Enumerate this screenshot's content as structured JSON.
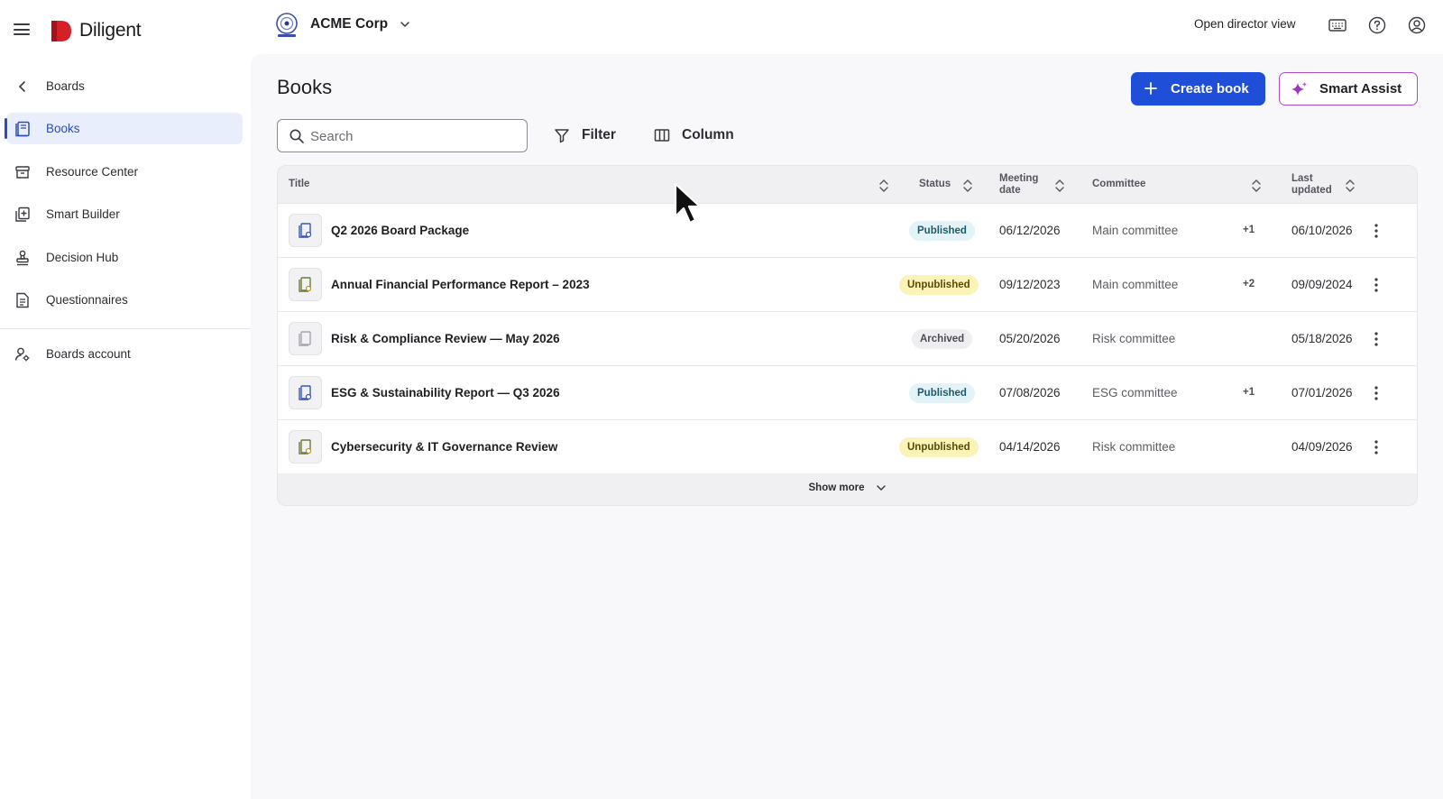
{
  "app": {
    "brand": "Diligent",
    "org_name": "ACME Corp",
    "director_link": "Open director view"
  },
  "sidebar": {
    "back_label": "Boards",
    "items": [
      {
        "label": "Books",
        "icon": "book-icon",
        "active": true
      },
      {
        "label": "Resource Center",
        "icon": "archive-icon",
        "active": false
      },
      {
        "label": "Smart Builder",
        "icon": "smart-builder-icon",
        "active": false
      },
      {
        "label": "Decision Hub",
        "icon": "stamp-icon",
        "active": false
      },
      {
        "label": "Questionnaires",
        "icon": "document-list-icon",
        "active": false
      }
    ],
    "account_label": "Boards account"
  },
  "page": {
    "title": "Books",
    "create_label": "Create book",
    "smart_assist_label": "Smart Assist",
    "search_placeholder": "Search",
    "filter_label": "Filter",
    "column_label": "Column",
    "show_more_label": "Show more"
  },
  "table": {
    "headers": {
      "title": "Title",
      "status": "Status",
      "meeting_date_1": "Meeting",
      "meeting_date_2": "date",
      "committee": "Committee",
      "last_updated_1": "Last",
      "last_updated_2": "updated"
    },
    "rows": [
      {
        "title": "Q2 2026 Board Package",
        "status": "Published",
        "meeting_date": "06/12/2026",
        "committee": "Main committee",
        "extra": "+1",
        "updated": "06/10/2026"
      },
      {
        "title": "Annual Financial Performance Report – 2023",
        "status": "Unpublished",
        "meeting_date": "09/12/2023",
        "committee": "Main committee",
        "extra": "+2",
        "updated": "09/09/2024"
      },
      {
        "title": "Risk & Compliance Review — May 2026",
        "status": "Archived",
        "meeting_date": "05/20/2026",
        "committee": "Risk committee",
        "extra": "",
        "updated": "05/18/2026"
      },
      {
        "title": "ESG & Sustainability Report — Q3 2026",
        "status": "Published",
        "meeting_date": "07/08/2026",
        "committee": "ESG committee",
        "extra": "+1",
        "updated": "07/01/2026"
      },
      {
        "title": "Cybersecurity & IT Governance Review",
        "status": "Unpublished",
        "meeting_date": "04/14/2026",
        "committee": "Risk committee",
        "extra": "",
        "updated": "04/09/2026"
      }
    ]
  },
  "colors": {
    "primary": "#1f4fd8",
    "brand_red": "#d62028",
    "smart_assist_border": "#b04ac8",
    "active_nav": "#2a4dbc"
  }
}
